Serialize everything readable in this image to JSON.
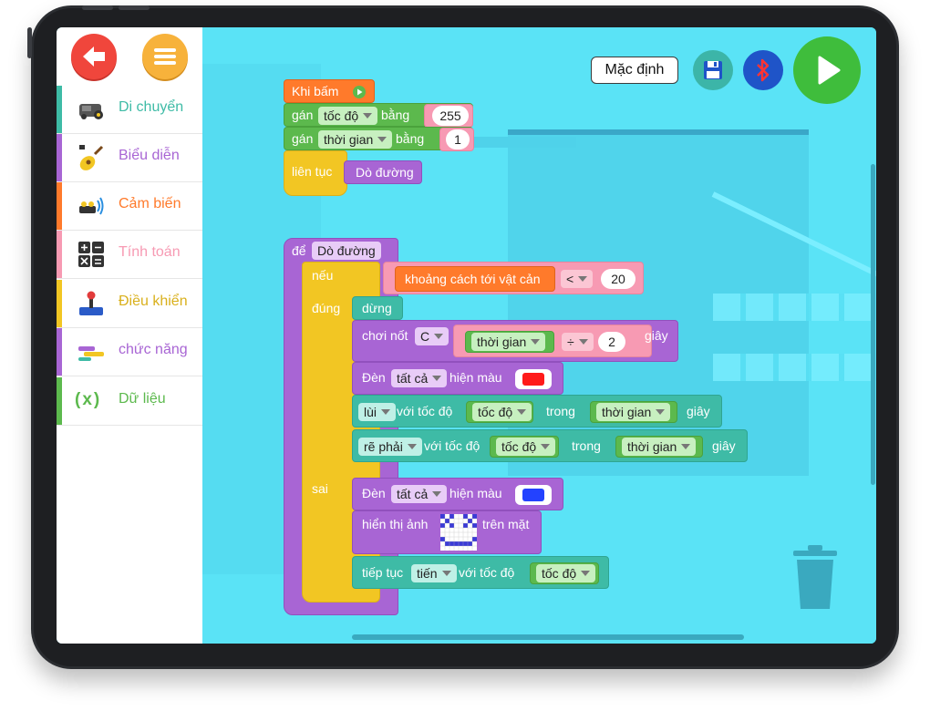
{
  "sidebar": {
    "categories": [
      {
        "label": "Di chuyển",
        "color": "#3ebba6",
        "icon": "robot-car-icon"
      },
      {
        "label": "Biểu diễn",
        "color": "#a865d4",
        "icon": "guitar-icon"
      },
      {
        "label": "Cảm biến",
        "color": "#ff7a2b",
        "icon": "sensor-icon"
      },
      {
        "label": "Tính toán",
        "color": "#f79ab3",
        "icon": "calculator-icon"
      },
      {
        "label": "Điều khiển",
        "color": "#f2c623",
        "icon": "joystick-icon"
      },
      {
        "label": "chức năng",
        "color": "#a865d4",
        "icon": "function-icon"
      },
      {
        "label": "Dữ liệu",
        "color": "#5cb94d",
        "icon": "variable-icon",
        "glyph": "(x)"
      }
    ]
  },
  "toolbar": {
    "default_label": "Mặc định"
  },
  "blocks": {
    "start": {
      "label": "Khi bấm"
    },
    "set_speed": {
      "prefix": "gán",
      "var": "tốc độ",
      "op": "bằng",
      "value": "255"
    },
    "set_time": {
      "prefix": "gán",
      "var": "thời gian",
      "op": "bằng",
      "value": "1"
    },
    "forever": {
      "label": "liên tục",
      "call": "Dò đường"
    },
    "func": {
      "label": "để",
      "name": "Dò đường"
    },
    "if_block": {
      "if_label": "nếu",
      "sensor": "khoảng cách tới vật cản",
      "compare": "<",
      "compare_value": "20",
      "true_label": "đúng",
      "false_label": "sai"
    },
    "stop": {
      "label": "dừng"
    },
    "play_note": {
      "label": "chơi nốt",
      "note": "C",
      "time_var": "thời gian",
      "div_op": "÷",
      "div_value": "2",
      "unit": "giây"
    },
    "led_red": {
      "label": "Đèn",
      "target": "tất cả",
      "action": "hiện màu",
      "color": "#ff1a1a"
    },
    "backward": {
      "dir": "lùi",
      "with": "với tốc độ",
      "speed": "tốc độ",
      "during": "trong",
      "time": "thời gian",
      "unit": "giây"
    },
    "turn_right": {
      "dir": "rẽ phải",
      "with": "với tốc độ",
      "speed": "tốc độ",
      "during": "trong",
      "time": "thời gian",
      "unit": "giây"
    },
    "led_blue": {
      "label": "Đèn",
      "target": "tất cả",
      "action": "hiện màu",
      "color": "#2342ff"
    },
    "show_face": {
      "label": "hiển thị ảnh",
      "suffix": "trên mặt"
    },
    "continue": {
      "label": "tiếp tục",
      "dir": "tiến",
      "with": "với tốc độ",
      "speed": "tốc độ"
    }
  }
}
